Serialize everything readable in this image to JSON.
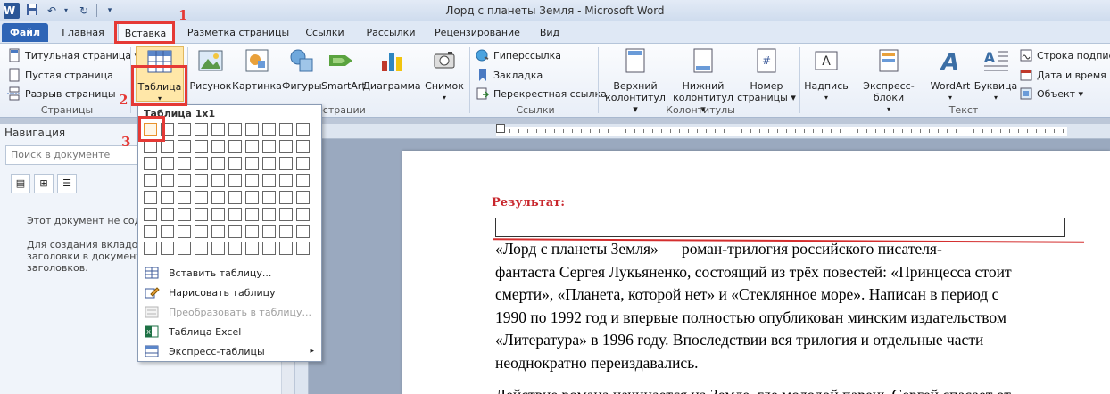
{
  "window": {
    "title": "Лорд с планеты Земля - Microsoft Word",
    "word_logo": "W"
  },
  "tabs": [
    "Файл",
    "Главная",
    "Вставка",
    "Разметка страницы",
    "Ссылки",
    "Рассылки",
    "Рецензирование",
    "Вид"
  ],
  "ribbon": {
    "pages_group": {
      "label": "Страницы",
      "items": [
        "Титульная страница ▾",
        "Пустая страница",
        "Разрыв страницы"
      ]
    },
    "table_button": {
      "label": "Таблица"
    },
    "illustrations_group": {
      "label": "Иллюстрации",
      "buttons": [
        "Рисунок",
        "Картинка",
        "Фигуры",
        "SmartArt",
        "Диаграмма",
        "Снимок"
      ]
    },
    "links_group": {
      "label": "Ссылки",
      "items": [
        "Гиперссылка",
        "Закладка",
        "Перекрестная ссылка"
      ]
    },
    "header_footer_group": {
      "label": "Колонтитулы",
      "buttons": [
        {
          "line1": "Верхний",
          "line2": "колонтитул ▾"
        },
        {
          "line1": "Нижний",
          "line2": "колонтитул ▾"
        },
        {
          "line1": "Номер",
          "line2": "страницы ▾"
        }
      ]
    },
    "text_group": {
      "label": "Текст",
      "buttons": [
        "Надпись",
        "Экспресс-блоки",
        "WordArt",
        "Буквица"
      ],
      "side_items": [
        "Строка подписи ▾",
        "Дата и время",
        "Объект ▾"
      ]
    }
  },
  "nav_panel": {
    "title": "Навигация",
    "search_placeholder": "Поиск в документе",
    "msg1": "Этот документ не содер",
    "msg2_lines": [
      "Для создания вкладок н",
      "заголовки в документе,",
      "заголовков."
    ]
  },
  "dropdown": {
    "title": "Таблица 1x1",
    "grid": {
      "cols": 10,
      "rows": 8,
      "selected": [
        1,
        1
      ]
    },
    "items": [
      {
        "label": "Вставить таблицу...",
        "disabled": false
      },
      {
        "label": "Нарисовать таблицу",
        "disabled": false
      },
      {
        "label": "Преобразовать в таблицу...",
        "disabled": true
      },
      {
        "label": "Таблица Excel",
        "disabled": false
      },
      {
        "label": "Экспресс-таблицы",
        "disabled": false,
        "submenu_arrow": "▸"
      }
    ]
  },
  "document": {
    "result_label": "Результат:",
    "paragraph1_lines": [
      "«Лорд  с  планеты  Земля» —  роман-трилогия российского писателя-",
      "фантаста Сергея Лукьяненко, состоящий из трёх повестей: «Принцесса стоит",
      "смерти», «Планета, которой нет» и «Стеклянное море». Написан в период с",
      "1990 по 1992 год и впервые полностью опубликован минским издательством",
      "«Литература» в 1996 году. Впоследствии вся трилогия и отдельные части",
      "неоднократно переиздавались."
    ],
    "paragraph2_partial": "Действие романа начинается на Земле, где молодой парень Сергей спасает от"
  },
  "callouts": [
    "1",
    "2",
    "3"
  ],
  "colors": {
    "file_tab": "#2f65b6",
    "callout_red": "#e53935",
    "result_red": "#c8262c",
    "selected_cell": "#e8922c"
  }
}
